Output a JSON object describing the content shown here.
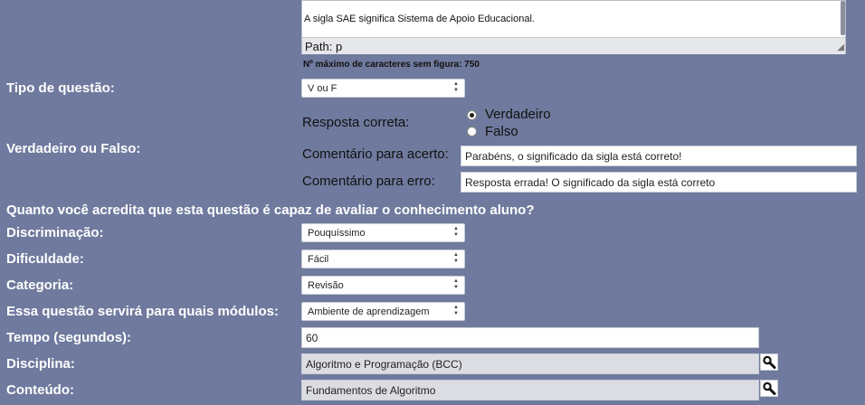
{
  "editor": {
    "content": "A sigla SAE significa Sistema de Apoio Educacional.",
    "path": "Path: p"
  },
  "max_chars_note": "Nº máximo de caracteres sem figura: 750",
  "question_type": {
    "label": "Tipo de questão:",
    "value": "V ou F"
  },
  "true_false": {
    "label": "Verdadeiro ou Falso:",
    "correct_answer_label": "Resposta correta:",
    "options": [
      "Verdadeiro",
      "Falso"
    ],
    "selected": "Verdadeiro",
    "comment_correct_label": "Comentário para acerto:",
    "comment_correct_value": "Parabéns, o significado da sigla está correto!",
    "comment_wrong_label": "Comentário para erro:",
    "comment_wrong_value": "Resposta errada! O significado da  sigla está correto"
  },
  "assessment_question": "Quanto você acredita que esta questão é capaz de avaliar o conhecimento aluno?",
  "discrimination": {
    "label": "Discriminação:",
    "value": "Pouquíssimo"
  },
  "difficulty": {
    "label": "Dificuldade:",
    "value": "Fácil"
  },
  "category": {
    "label": "Categoria:",
    "value": "Revisão"
  },
  "modules": {
    "label": "Essa questão servirá para quais módulos:",
    "value": "Ambiente de aprendizagem"
  },
  "time": {
    "label": "Tempo (segundos):",
    "value": "60"
  },
  "discipline": {
    "label": "Disciplina:",
    "value": "Algoritmo e Programação (BCC)"
  },
  "content": {
    "label": "Conteúdo:",
    "value": "Fundamentos de Algoritmo"
  },
  "icons": {
    "search": "magnifier-icon"
  }
}
